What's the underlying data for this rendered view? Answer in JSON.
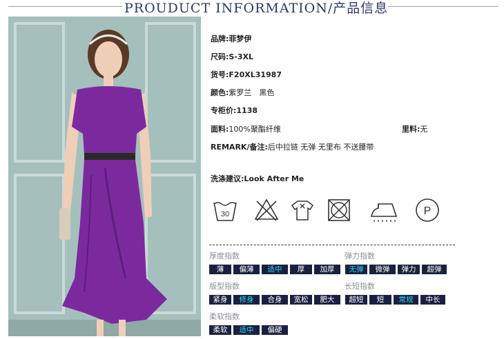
{
  "header": {
    "title": "PROUDUCT INFORMATION/产品信息"
  },
  "photo": {
    "alt": "model in purple dress"
  },
  "info": {
    "brand_label": "品牌:",
    "brand_value": "菲梦伊",
    "size_label": "尺码:",
    "size_value": "S-3XL",
    "sku_label": "货号:",
    "sku_value": "F20XL31987",
    "color_label": "颜色:",
    "color_value": "紫罗兰　黑色",
    "price_label": "专柜价:",
    "price_value": "1138",
    "fabric_label": "面料:",
    "fabric_value": "100%聚酯纤维",
    "lining_label": "里料:",
    "lining_value": "无",
    "remark_label": "REMARK/备注:",
    "remark_value": "后中拉链 无弹 无里布 不送腰带",
    "wash_label": "洗涤建议:",
    "wash_value": "Look After Me"
  },
  "care_icons": {
    "wash_temp": "30",
    "names": [
      "wash-30-icon",
      "no-bleach-icon",
      "hang-dry-icon",
      "no-tumble-dry-icon",
      "iron-icon",
      "dry-clean-p-icon"
    ],
    "dry_clean_letter": "P"
  },
  "attributes": {
    "thickness": {
      "label": "厚度指数",
      "options": [
        "薄",
        "偏薄",
        "适中",
        "厚",
        "加厚"
      ],
      "selected": "适中"
    },
    "elasticity": {
      "label": "弹力指数",
      "options": [
        "无弹",
        "微弹",
        "弹力",
        "超弹"
      ],
      "selected": "无弹"
    },
    "fit": {
      "label": "版型指数",
      "options": [
        "紧身",
        "修身",
        "合身",
        "宽松",
        "肥大"
      ],
      "selected": "修身"
    },
    "length": {
      "label": "长短指数",
      "options": [
        "超短",
        "短",
        "常规",
        "中长"
      ],
      "selected": "常规"
    },
    "softness": {
      "label": "柔软指数",
      "options": [
        "柔软",
        "适中",
        "偏硬"
      ],
      "selected": "适中"
    }
  },
  "colors": {
    "chip_bg": "#1a2140",
    "chip_selected_text": "#2fd6f0",
    "dress": "#7b2a9e"
  }
}
